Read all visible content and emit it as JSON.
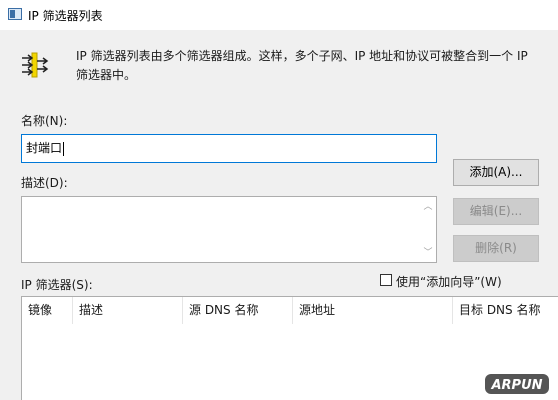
{
  "window": {
    "title": "IP 筛选器列表"
  },
  "header": {
    "description": "IP 筛选器列表由多个筛选器组成。这样，多个子网、IP 地址和协议可被整合到一个 IP 筛选器中。"
  },
  "name_field": {
    "label": "名称(N):",
    "value": "封端口"
  },
  "description_field": {
    "label": "描述(D):",
    "value": ""
  },
  "buttons": {
    "add": "添加(A)...",
    "edit": "编辑(E)...",
    "delete": "删除(R)"
  },
  "filters": {
    "label": "IP 筛选器(S):",
    "use_wizard_label": "使用“添加向导”(W)",
    "use_wizard_checked": false,
    "columns": [
      "镜像",
      "描述",
      "源 DNS 名称",
      "源地址",
      "目标 DNS 名称"
    ],
    "rows": []
  },
  "watermark": {
    "text": "ARPUN"
  }
}
